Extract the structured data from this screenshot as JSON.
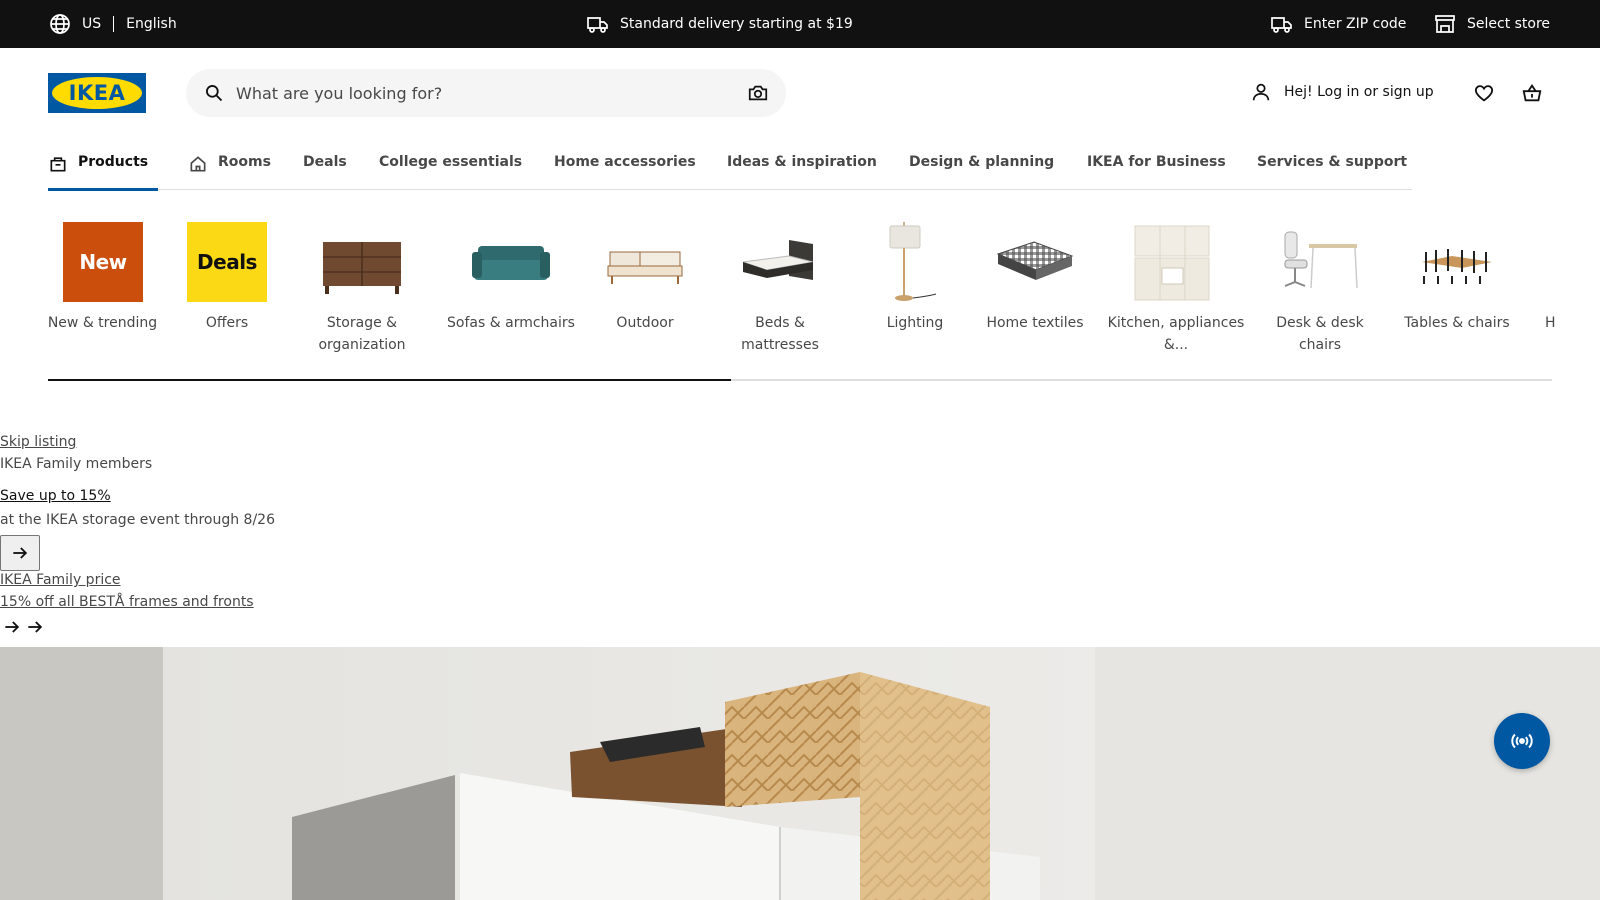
{
  "topbar": {
    "country": "US",
    "language": "English",
    "delivery_text": "Standard delivery starting at $19",
    "zip_label": "Enter ZIP code",
    "store_label": "Select store"
  },
  "header": {
    "logo_text": "IKEA",
    "search_placeholder": "What are you looking for?",
    "login_label": "Hej! Log in or sign up"
  },
  "nav": {
    "tabs": [
      {
        "label": "Products",
        "active": true
      },
      {
        "label": "Rooms"
      },
      {
        "label": "Deals"
      },
      {
        "label": "College essentials"
      },
      {
        "label": "Home accessories"
      },
      {
        "label": "Ideas & inspiration"
      },
      {
        "label": "Design & planning"
      },
      {
        "label": "IKEA for Business"
      },
      {
        "label": "Services & support"
      }
    ]
  },
  "categories": [
    {
      "label": "New & trending",
      "badge": "New"
    },
    {
      "label": "Offers",
      "badge": "Deals"
    },
    {
      "label": "Storage & organization"
    },
    {
      "label": "Sofas & armchairs"
    },
    {
      "label": "Outdoor"
    },
    {
      "label": "Beds & mattresses"
    },
    {
      "label": "Lighting"
    },
    {
      "label": "Home textiles"
    },
    {
      "label": "Kitchen, appliances &..."
    },
    {
      "label": "Desk & desk chairs"
    },
    {
      "label": "Tables & chairs"
    },
    {
      "label": "H"
    }
  ],
  "promo": {
    "skip_link": "Skip listing",
    "family_members": "IKEA Family members",
    "save_link": "Save up to 15%",
    "event_text": "at the IKEA storage event through 8/26",
    "family_price_link": "IKEA Family price",
    "besta_link": "15% off all BESTÅ frames and fronts"
  },
  "colors": {
    "brand_blue": "#0058a3",
    "brand_yellow": "#ffdb00",
    "new_badge": "#cc4e0c",
    "deals_badge": "#fbd914",
    "topbar_bg": "#111111"
  }
}
